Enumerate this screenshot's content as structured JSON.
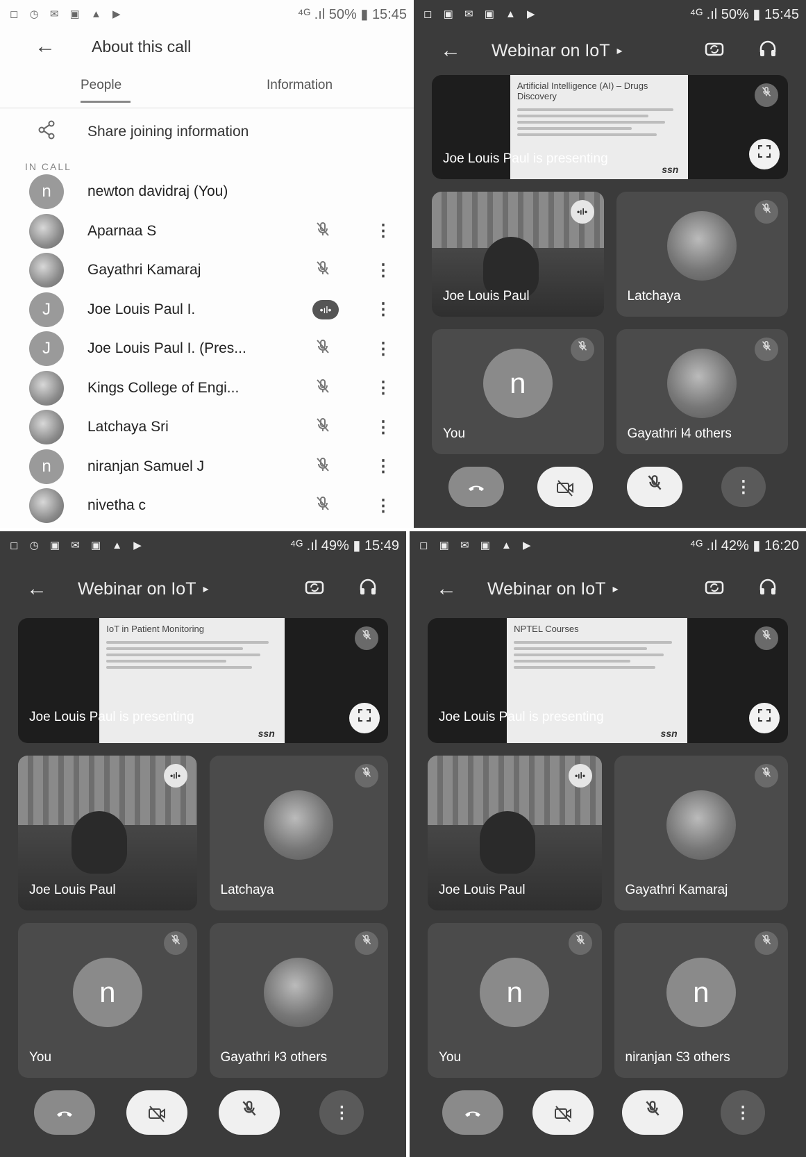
{
  "about": {
    "status": {
      "icons": "◻ ◷ ✉ ▣ ▲ ▶",
      "network": "⁴ᴳ .ıl",
      "battery": "50%",
      "time": "15:45"
    },
    "title": "About this call",
    "tabs": [
      "People",
      "Information"
    ],
    "share_label": "Share joining information",
    "in_call_label": "IN CALL",
    "participants": [
      {
        "name": "newton davidraj (You)",
        "initial": "n",
        "photo": false,
        "state": "none"
      },
      {
        "name": "Aparnaa S",
        "initial": "",
        "photo": true,
        "state": "muted"
      },
      {
        "name": "Gayathri Kamaraj",
        "initial": "",
        "photo": true,
        "state": "muted"
      },
      {
        "name": "Joe Louis Paul I.",
        "initial": "J",
        "photo": false,
        "state": "speaking"
      },
      {
        "name": "Joe Louis Paul I. (Pres...",
        "initial": "J",
        "photo": false,
        "state": "muted"
      },
      {
        "name": "Kings College of Engi...",
        "initial": "",
        "photo": true,
        "state": "muted"
      },
      {
        "name": "Latchaya Sri",
        "initial": "",
        "photo": true,
        "state": "muted"
      },
      {
        "name": "niranjan Samuel J",
        "initial": "n",
        "photo": false,
        "state": "muted"
      },
      {
        "name": "nivetha c",
        "initial": "",
        "photo": true,
        "state": "muted"
      }
    ]
  },
  "calls": [
    {
      "status": {
        "icons": "◻ ▣ ✉ ▣ ▲ ▶",
        "network": "⁴ᴳ .ıl",
        "battery": "50%",
        "time": "15:45"
      },
      "meeting": "Webinar on IoT",
      "slide_title": "Artificial Intelligence (AI) – Drugs Discovery",
      "presenter": "Joe Louis Paul is presenting",
      "tiles": [
        "Joe Louis Paul",
        "Latchaya",
        "You",
        "Gayathri Kamaraj",
        "4 others"
      ]
    },
    {
      "status": {
        "icons": "◻ ◷ ▣ ✉ ▣ ▲ ▶",
        "network": "⁴ᴳ .ıl",
        "battery": "49%",
        "time": "15:49"
      },
      "meeting": "Webinar on IoT",
      "slide_title": "IoT in Patient Monitoring",
      "presenter": "Joe Louis Paul is presenting",
      "tiles": [
        "Joe Louis Paul",
        "Latchaya",
        "You",
        "Gayathri Kamaraj",
        "3 others"
      ]
    },
    {
      "status": {
        "icons": "◻ ▣ ✉ ▣ ▲ ▶",
        "network": "⁴ᴳ .ıl",
        "battery": "42%",
        "time": "16:20"
      },
      "meeting": "Webinar on IoT",
      "slide_title": "NPTEL Courses",
      "presenter": "Joe Louis Paul is presenting",
      "tiles": [
        "Joe Louis Paul",
        "Gayathri Kamaraj",
        "You",
        "niranjan Samuel J",
        "3 others"
      ]
    }
  ],
  "icons": {
    "back": "←",
    "share": "⋘",
    "mute": "🎤̸",
    "more": "⋮",
    "speaking": "•ıl•",
    "switch_camera": "⟳",
    "audio": "🎧",
    "fullscreen": "⛶",
    "end_call": "☎",
    "camera_off": "▭̸",
    "caret": "▸"
  },
  "ssn_logo": "ssn"
}
